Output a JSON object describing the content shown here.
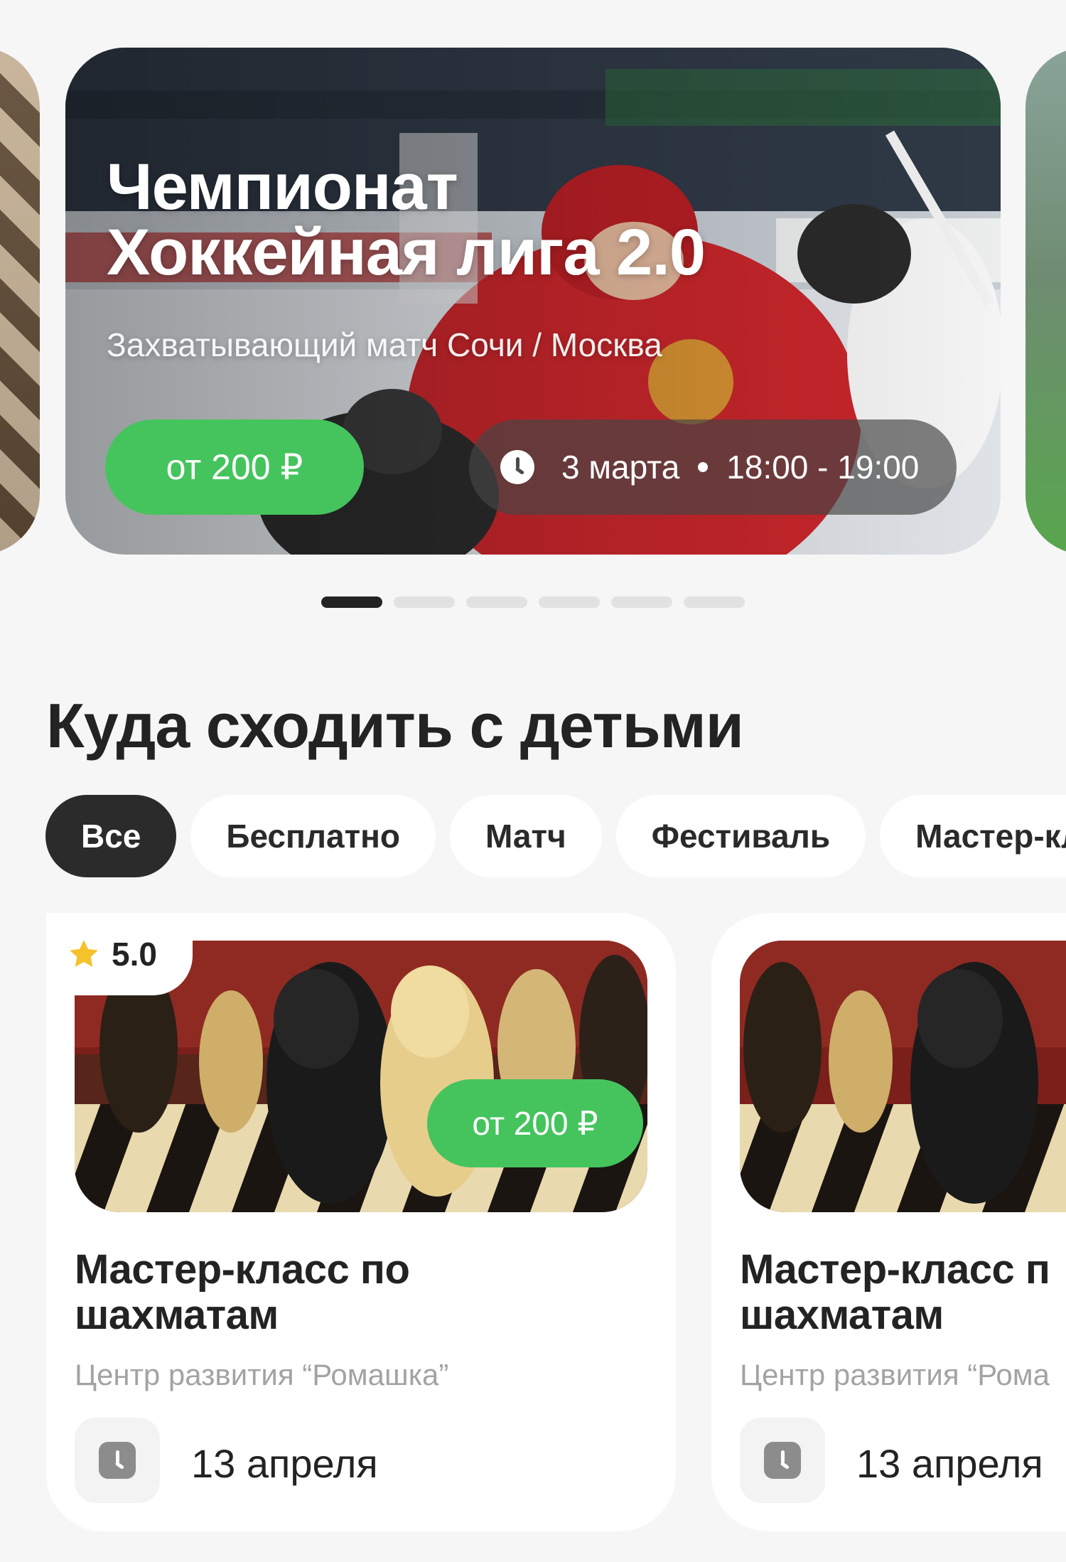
{
  "hero": {
    "title_line1": "Чемпионат",
    "title_line2": "Хоккейная лига 2.0",
    "subtitle": "Захватывающий матч Сочи / Москва",
    "price": "от 200 ₽",
    "date": "3 марта",
    "time": "18:00 - 19:00",
    "image_icon": "hockey-players-photo"
  },
  "pager": {
    "count": 6,
    "active_index": 0
  },
  "section": {
    "title": "Куда сходить с детьми",
    "chips": [
      {
        "label": "Все",
        "active": true
      },
      {
        "label": "Бесплатно",
        "active": false
      },
      {
        "label": "Матч",
        "active": false
      },
      {
        "label": "Фестиваль",
        "active": false
      },
      {
        "label": "Мастер-кл",
        "active": false
      }
    ]
  },
  "cards": [
    {
      "rating": "5.0",
      "price": "от 200 ₽",
      "title_line1": "Мастер-класс по",
      "title_line2": "шахматам",
      "organizer": "Центр развития “Ромашка”",
      "date": "13 апреля",
      "image_icon": "chess-pieces-photo"
    },
    {
      "title_line1": "Мастер-класс п",
      "title_line2": "шахматам",
      "organizer": "Центр развития “Рома",
      "date": "13 апреля",
      "image_icon": "chess-pieces-photo"
    }
  ],
  "colors": {
    "accent_green": "#45C45D",
    "text_dark": "#232323",
    "chip_active": "#2B2B2B",
    "muted_text": "#A3A3A3",
    "background": "#F6F6F6"
  }
}
